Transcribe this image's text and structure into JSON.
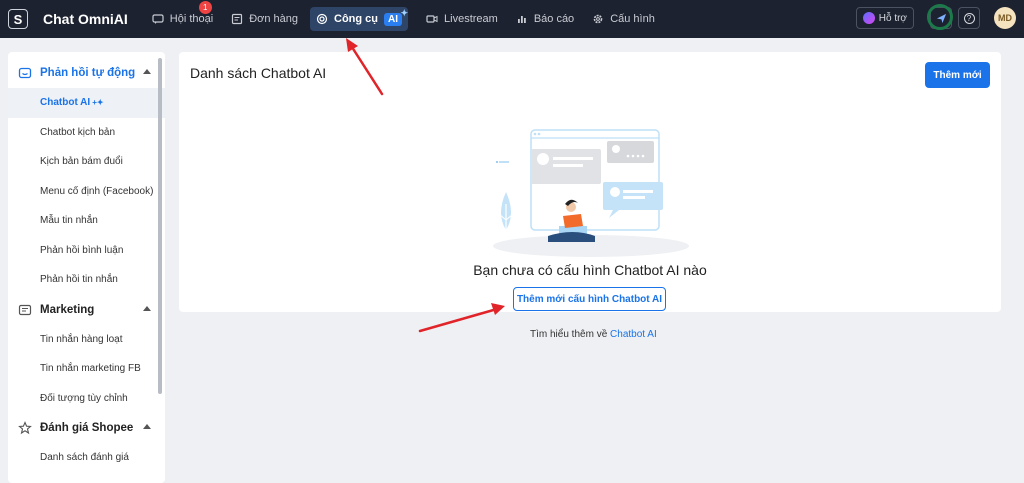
{
  "header": {
    "logo_letter": "S",
    "app_title": "Chat OmniAI",
    "nav": [
      {
        "label": "Hội thoại",
        "icon": "chat-icon",
        "badge": "1"
      },
      {
        "label": "Đơn hàng",
        "icon": "order-icon"
      },
      {
        "label": "Công cụ",
        "icon": "tools-icon",
        "ai_label": "AI",
        "active": true
      },
      {
        "label": "Livestream",
        "icon": "video-icon"
      },
      {
        "label": "Báo cáo",
        "icon": "chart-icon"
      },
      {
        "label": "Cấu hình",
        "icon": "gear-icon"
      }
    ],
    "support_label": "Hỗ trợ",
    "help_icon": "?",
    "avatar_initials": "MD"
  },
  "sidebar": {
    "groups": [
      {
        "title": "Phản hồi tự động",
        "icon": "auto-reply-icon",
        "items": [
          {
            "label": "Chatbot AI",
            "active": true
          },
          {
            "label": "Chatbot kịch bản"
          },
          {
            "label": "Kịch bản bám đuổi"
          },
          {
            "label": "Menu cố định (Facebook)"
          },
          {
            "label": "Mẫu tin nhắn"
          },
          {
            "label": "Phản hồi bình luận"
          },
          {
            "label": "Phản hồi tin nhắn"
          }
        ]
      },
      {
        "title": "Marketing",
        "icon": "marketing-icon",
        "items": [
          {
            "label": "Tin nhắn hàng loạt"
          },
          {
            "label": "Tin nhắn marketing FB"
          },
          {
            "label": "Đối tượng tùy chỉnh"
          }
        ]
      },
      {
        "title": "Đánh giá Shopee",
        "icon": "star-icon",
        "items": [
          {
            "label": "Danh sách đánh giá"
          }
        ]
      }
    ]
  },
  "main": {
    "title": "Danh sách Chatbot AI",
    "add_button": "Thêm mới",
    "empty_message": "Bạn chưa có cấu hình Chatbot AI nào",
    "add_config_button": "Thêm mới cấu hình Chatbot AI",
    "learn_more_prefix": "Tìm hiểu thêm về",
    "learn_more_link": "Chatbot AI"
  },
  "colors": {
    "accent": "#1a73e8",
    "topbar": "#1d2230",
    "annotation": "#e0242a"
  }
}
